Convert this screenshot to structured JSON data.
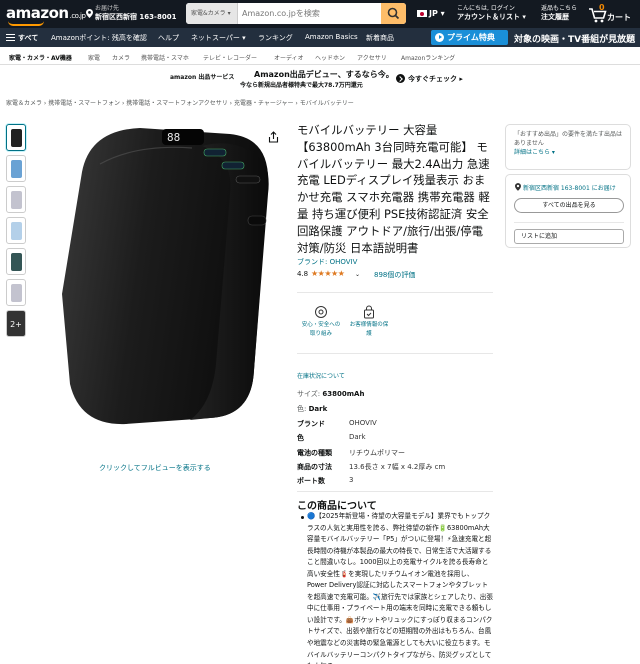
{
  "header": {
    "logo": "amazon",
    "logo_suffix": ".co.jp",
    "deliver_label": "お届け先",
    "deliver_address": "新宿区西新宿 163-8001",
    "search_category": "家電&カメラ ▾",
    "search_placeholder": "Amazon.co.jpを検索",
    "language": "JP ▾",
    "account_line1": "こんにちは, ログイン",
    "account_line2": "アカウント＆リスト ▾",
    "orders_line1": "返品もこちら",
    "orders_line2": "注文履歴",
    "cart_count": "0",
    "cart_label": "カート"
  },
  "nav": {
    "all": "すべて",
    "items": [
      "Amazonポイント: 残高を確認",
      "ヘルプ",
      "ネットスーパー ▾",
      "ランキング",
      "Amazon Basics",
      "新着商品"
    ],
    "prime": "プライム特典",
    "promo": "対象の映画・TV番組が見放題"
  },
  "subnav": [
    "家電・カメラ・AV機器",
    "家電",
    "カメラ",
    "携帯電話・スマホ",
    "テレビ・レコーダー",
    "オーディオ",
    "ヘッドホン",
    "アクセサリ",
    "Amazonランキング"
  ],
  "banner": {
    "service": "amazon 出品サービス",
    "line1": "Amazon出品デビュー、するなら今。",
    "line2": "今なら新規出品者様特典で最大78.7万円還元",
    "check": "今すぐチェック ▸"
  },
  "breadcrumb": "家電＆カメラ › 携帯電話・スマートフォン › 携帯電話・スマートフォンアクセサリ › 充電器・チャージャー › モバイルバッテリー",
  "gallery": {
    "more_label": "2+",
    "caption": "クリックしてフルビューを表示する"
  },
  "product": {
    "title": "モバイルバッテリー 大容量 【63800mAh 3台同時充電可能】 モバイルバッテリー 最大2.4A出力 急速充電 LEDディスプレイ残量表示 おまかせ充電 スマホ充電器 携帯充電器 軽量 持ち運び便利 PSE技術認証済 安全回路保護 アウトドア/旅行/出張/停電対策/防災 日本語説明書",
    "brand": "ブランド: OHOVIV",
    "rating": "4.8",
    "stars": "★★★★★",
    "rating_count": "898個の評価",
    "badges": [
      "安心・安全への取り組み",
      "お客様情報の保護"
    ],
    "stock_link": "在庫状況について",
    "size_label": "サイズ: ",
    "size_value": "63800mAh",
    "color_label": "色: ",
    "color_value": "Dark",
    "specs": [
      {
        "k": "ブランド",
        "v": "OHOVIV"
      },
      {
        "k": "色",
        "v": "Dark"
      },
      {
        "k": "電池の種類",
        "v": "リチウムポリマー"
      },
      {
        "k": "商品の寸法",
        "v": "13.6長さ x 7幅 x 4.2厚み cm"
      },
      {
        "k": "ポート数",
        "v": "3"
      }
    ],
    "about_heading": "この商品について",
    "about_text": "🔵【2025年新登場・待望の大容量モデル】業界でもトップクラスの人気と実用性を誇る、弊社待望の新作🔋63800mAh大容量モバイルバッテリー「P5」がついに登場！⚡急速充電と超長時間の待機が本製品の最大の特長で、日常生活で大活躍すること間違いなし。1000回以上の充電サイクルを誇る長寿命と高い安全性🧯を実現したリチウムイオン電池を採用し、Power Delivery認証に対応したスマートフォンやタブレットを超高速で充電可能。✈️旅行先では家族とシェアしたり、出張中に仕事用・プライベート用の端末を同時に充電できる頼もしい設計です。👜ポケットやリュックにすっぽり収まるコンパクトサイズで、出張や旅行などの短期間の外出はもちろん、台風や地震などの災害時の緊急電源としても大いに役立ちます。モバイルバッテリーコンパクトタイプながら、防災グッズとしても人気の"
  },
  "buybox": {
    "note": "「おすすめ出品」の要件を満たす出品はありません",
    "details": "詳細はこちら ▾",
    "location": "新宿区西新宿 163-8001 にお届け",
    "see_all": "すべての出品を見る",
    "add_list": "リストに追加"
  },
  "colors": {
    "nav_dark": "#131921",
    "nav_2": "#232f3e",
    "accent": "#ff9900",
    "link": "#007185",
    "star": "#de7921",
    "prime": "#1a8fd8"
  }
}
